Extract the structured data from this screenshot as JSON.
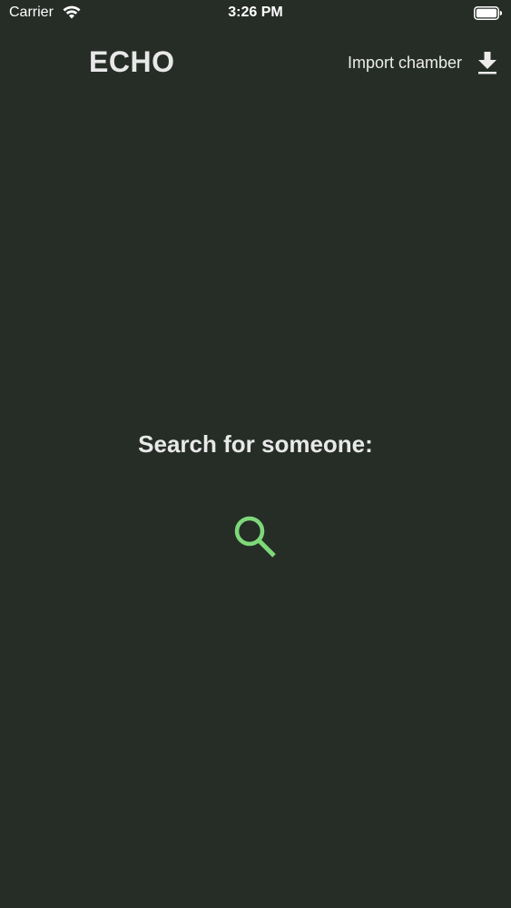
{
  "status_bar": {
    "carrier": "Carrier",
    "time": "3:26 PM",
    "wifi_icon": "wifi-icon",
    "battery_icon": "battery-icon"
  },
  "header": {
    "title": "ECHO",
    "import_label": "Import chamber",
    "import_icon": "download-icon"
  },
  "main": {
    "prompt": "Search for someone:",
    "search_icon": "search-icon"
  },
  "colors": {
    "background": "#262d27",
    "text": "#e8e8e8",
    "accent": "#7ed879"
  }
}
